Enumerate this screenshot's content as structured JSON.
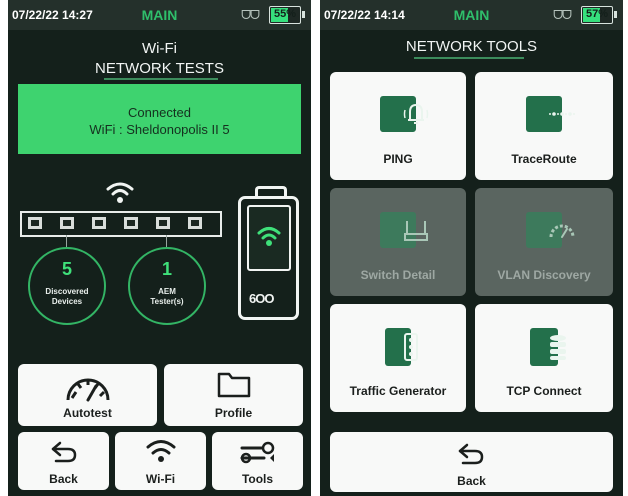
{
  "left_screen": {
    "status": {
      "datetime": "07/22/22 14:27",
      "mode": "MAIN",
      "network": "ᗜᗜ",
      "battery": "55%",
      "battery_level": 0.55
    },
    "title_line1": "Wi-Fi",
    "title_line2": "NETWORK TESTS",
    "connection": {
      "status": "Connected",
      "network": "WiFi : Sheldonopolis II 5"
    },
    "discovered": {
      "count": "5",
      "label_line1": "Discovered",
      "label_line2": "Devices"
    },
    "testers": {
      "count": "1",
      "label_line1": "AEM",
      "label_line2": "Tester(s)"
    },
    "device_logo": "6OO",
    "buttons": {
      "autotest": "Autotest",
      "profile": "Profile",
      "back": "Back",
      "wifi": "Wi-Fi",
      "tools": "Tools"
    }
  },
  "right_screen": {
    "status": {
      "datetime": "07/22/22 14:14",
      "mode": "MAIN",
      "network": "ᗜᗜ",
      "battery": "57%",
      "battery_level": 0.57
    },
    "title": "NETWORK TOOLS",
    "tools": {
      "ping": "PING",
      "traceroute": "TraceRoute",
      "switch_detail": "Switch Detail",
      "vlan_discovery": "VLAN Discovery",
      "traffic_generator": "Traffic Generator",
      "tcp_connect": "TCP Connect"
    },
    "back": "Back"
  },
  "colors": {
    "background": "#14201b",
    "accent": "#3ed36f",
    "icon": "#23704b",
    "button": "#f8f9f8"
  }
}
